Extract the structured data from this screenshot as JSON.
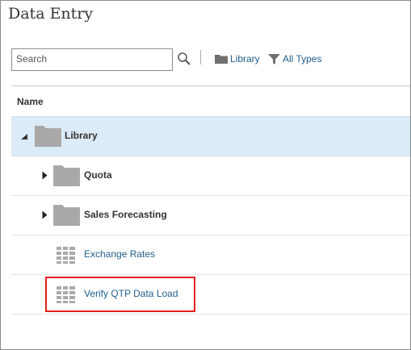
{
  "page": {
    "title": "Data Entry"
  },
  "toolbar": {
    "search_placeholder": "Search",
    "library_label": "Library",
    "types_label": "All Types"
  },
  "table": {
    "column_name": "Name",
    "rows": [
      {
        "label": "Library",
        "kind": "folder",
        "expanded": true,
        "selected": true
      },
      {
        "label": "Quota",
        "kind": "folder",
        "expanded": false
      },
      {
        "label": "Sales Forecasting",
        "kind": "folder",
        "expanded": false
      },
      {
        "label": "Exchange Rates",
        "kind": "form"
      },
      {
        "label": "Verify QTP Data Load",
        "kind": "form",
        "highlighted": true
      }
    ]
  },
  "colors": {
    "link": "#1f5f8b",
    "selected_row": "#dbebf8",
    "highlight": "#e41c1c"
  }
}
